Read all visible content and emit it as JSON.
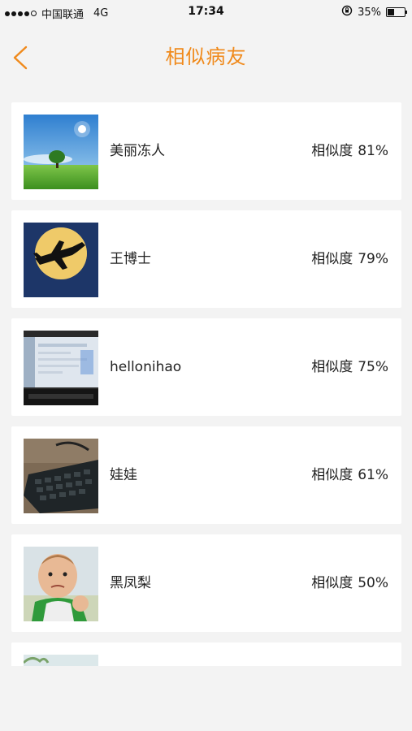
{
  "status": {
    "carrier": "中国联通",
    "network": "4G",
    "time": "17:34",
    "battery_text": "35%",
    "battery_level": 0.35
  },
  "header": {
    "title": "相似病友",
    "accent": "#f08a1c"
  },
  "similarity_label": "相似度",
  "friends": [
    {
      "name": "美丽冻人",
      "similarity": "81%",
      "avatar": "landscape-avatar"
    },
    {
      "name": "王博士",
      "similarity": "79%",
      "avatar": "moon-airplane-avatar"
    },
    {
      "name": "hellonihao",
      "similarity": "75%",
      "avatar": "monitor-avatar"
    },
    {
      "name": "娃娃",
      "similarity": "61%",
      "avatar": "keyboard-avatar"
    },
    {
      "name": "黑凤梨",
      "similarity": "50%",
      "avatar": "baby-avatar"
    }
  ]
}
